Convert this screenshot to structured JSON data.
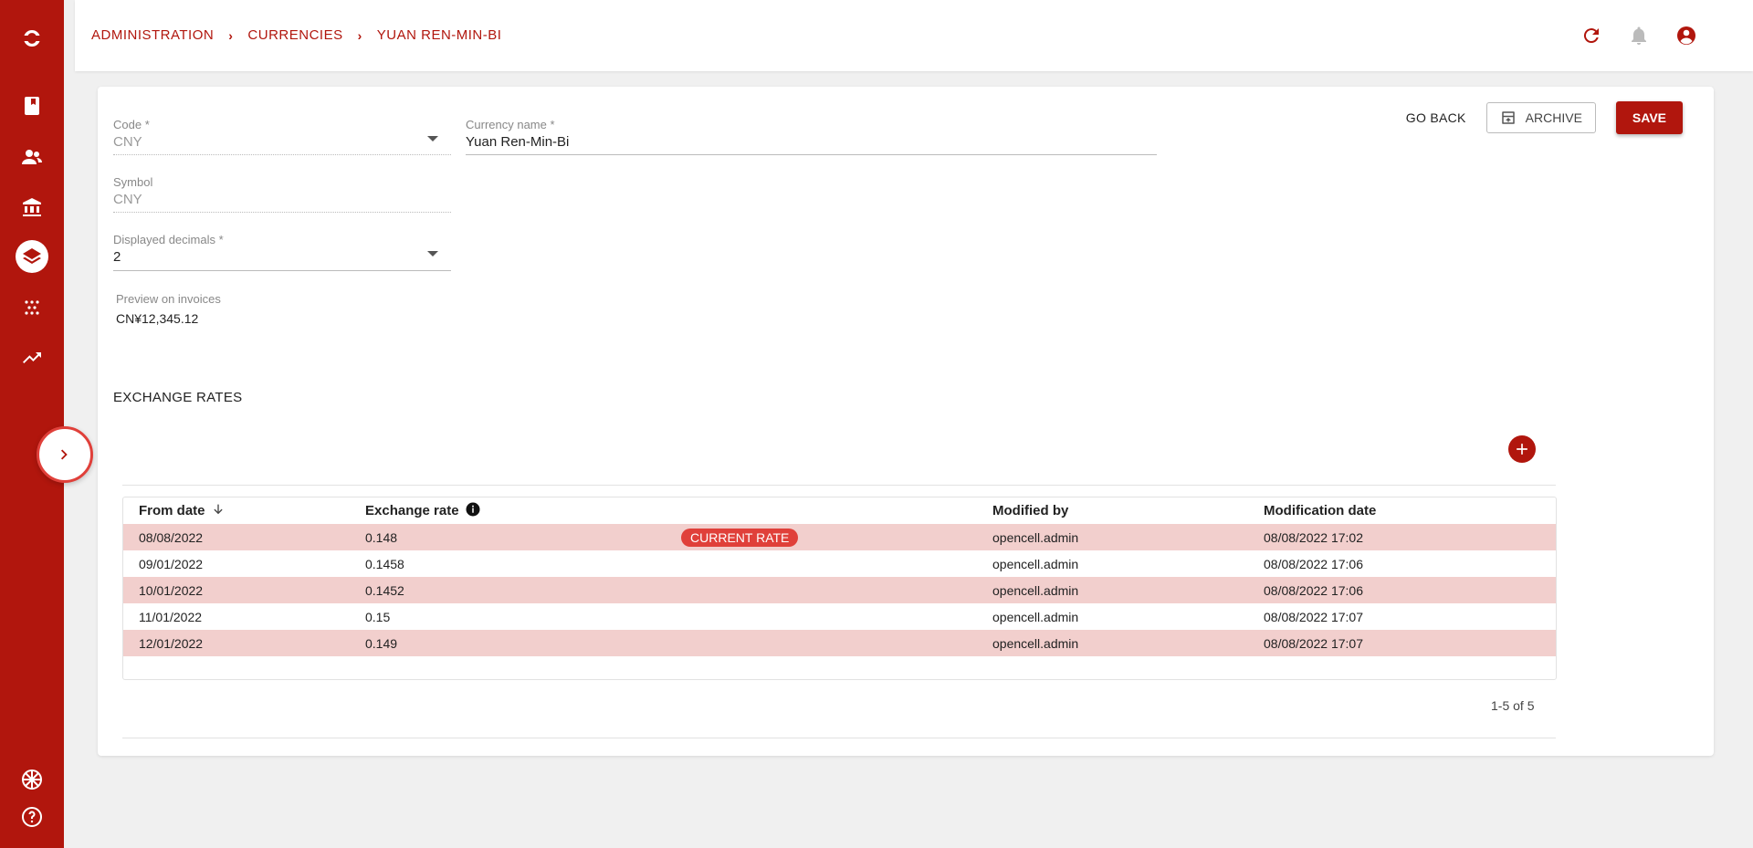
{
  "header": {
    "breadcrumb": [
      "ADMINISTRATION",
      "CURRENCIES",
      "YUAN REN-MIN-BI"
    ]
  },
  "colors": {
    "primary": "#b1160d",
    "accent": "#e0403a",
    "row_highlight": "#f2cfcd"
  },
  "sidebar": {
    "items": [
      {
        "icon": "logo-icon"
      },
      {
        "icon": "book-icon"
      },
      {
        "icon": "customers-icon"
      },
      {
        "icon": "bank-icon"
      },
      {
        "icon": "layers-icon",
        "active": true
      },
      {
        "icon": "dots-icon"
      },
      {
        "icon": "trending-up-icon"
      }
    ],
    "bottom": [
      {
        "icon": "uk-flag-icon"
      },
      {
        "icon": "help-icon"
      }
    ]
  },
  "form": {
    "code": {
      "label": "Code *",
      "value": "CNY"
    },
    "currency_name": {
      "label": "Currency name *",
      "value": "Yuan Ren-Min-Bi"
    },
    "symbol": {
      "label": "Symbol",
      "value": "CNY"
    },
    "decimals": {
      "label": "Displayed decimals *",
      "value": "2"
    },
    "preview": {
      "label": "Preview on invoices",
      "value": "CN¥12,345.12"
    }
  },
  "actions": {
    "go_back": "GO BACK",
    "archive": "ARCHIVE",
    "save": "SAVE"
  },
  "exchange_rates": {
    "title": "EXCHANGE RATES",
    "columns": [
      "From date",
      "Exchange rate",
      "Modified by",
      "Modification date"
    ],
    "current_badge": "CURRENT RATE",
    "rows": [
      {
        "from_date": "08/08/2022",
        "rate": "0.148",
        "modified_by": "opencell.admin",
        "modification_date": "08/08/2022 17:02",
        "current": true
      },
      {
        "from_date": "09/01/2022",
        "rate": "0.1458",
        "modified_by": "opencell.admin",
        "modification_date": "08/08/2022 17:06"
      },
      {
        "from_date": "10/01/2022",
        "rate": "0.1452",
        "modified_by": "opencell.admin",
        "modification_date": "08/08/2022 17:06"
      },
      {
        "from_date": "11/01/2022",
        "rate": "0.15",
        "modified_by": "opencell.admin",
        "modification_date": "08/08/2022 17:07"
      },
      {
        "from_date": "12/01/2022",
        "rate": "0.149",
        "modified_by": "opencell.admin",
        "modification_date": "08/08/2022 17:07"
      }
    ],
    "pagination": "1-5 of 5"
  }
}
